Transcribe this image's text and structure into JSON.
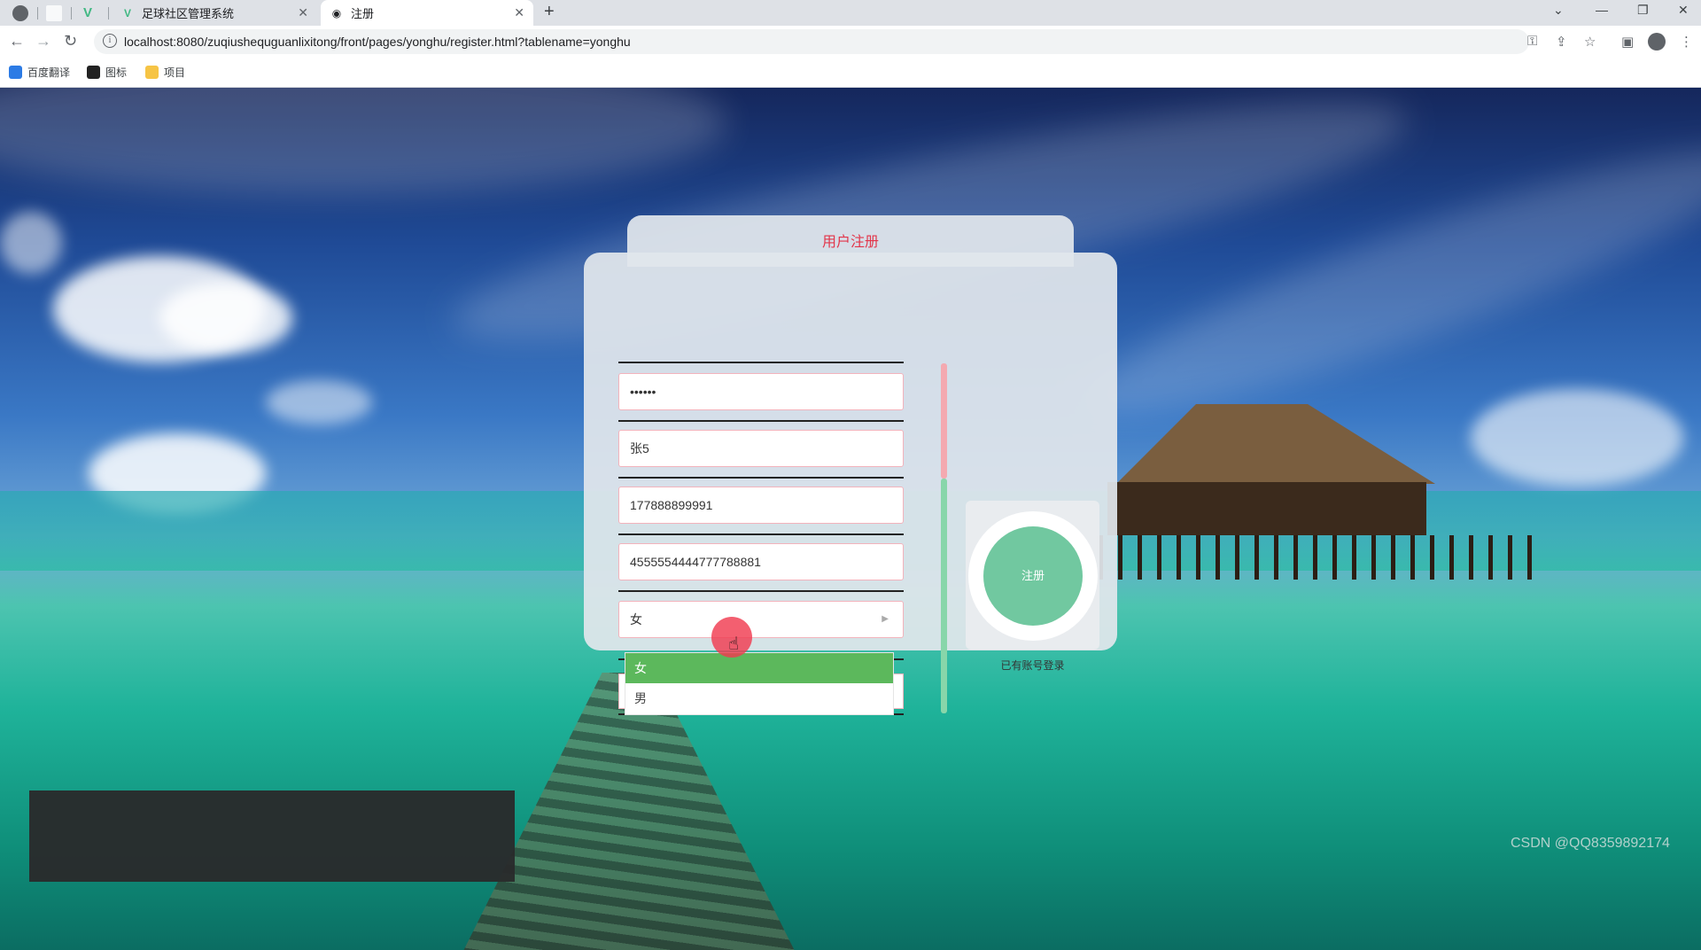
{
  "browser": {
    "tabs": [
      {
        "title": "足球社区管理系统",
        "close": "✕"
      },
      {
        "title": "注册",
        "close": "✕"
      }
    ],
    "new_tab": "+",
    "url": "localhost:8080/zuqiushequguanlixitong/front/pages/yonghu/register.html?tablename=yonghu",
    "bookmarks": [
      "百度翻译",
      "图标",
      "项目"
    ],
    "nav_icons": [
      "back-icon",
      "forward-icon",
      "reload-icon"
    ],
    "window_controls": [
      "chevron-down-icon",
      "minimize-icon",
      "restore-icon",
      "close-icon"
    ]
  },
  "register": {
    "title": "用户注册",
    "password": "••••••",
    "name": "张5",
    "phone": "177888899991",
    "id_number": "4555554444777788881",
    "gender_selected": "女",
    "gender_options": [
      "女",
      "男"
    ],
    "submit_label": "注册",
    "login_link": "已有账号登录"
  },
  "watermark": "CSDN @QQ8359892174",
  "colors": {
    "title": "#e2354a",
    "button": "#71c8a0",
    "selected_option": "#5cb85c",
    "field_border": "#f3b3bc"
  }
}
